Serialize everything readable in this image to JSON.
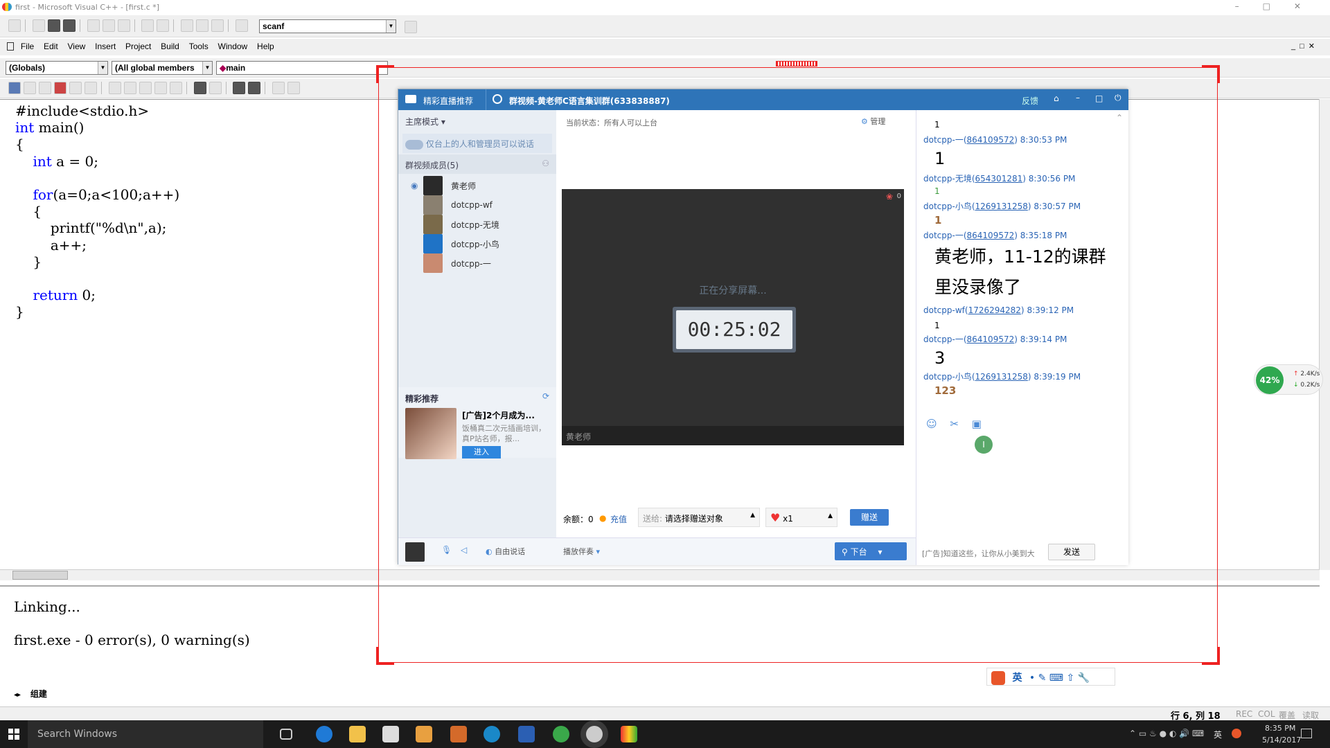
{
  "app": {
    "title": "first - Microsoft Visual C++ - [first.c *]"
  },
  "toolbar": {
    "find_combo": "scanf"
  },
  "menu": [
    "File",
    "Edit",
    "View",
    "Insert",
    "Project",
    "Build",
    "Tools",
    "Window",
    "Help"
  ],
  "wizard": {
    "class_combo": "(Globals)",
    "members_combo": "(All global members",
    "func_combo": "main"
  },
  "editor": {
    "lines": [
      "#include<stdio.h>",
      "int main()",
      "{",
      "    int a = 0;",
      "",
      "    for(a=0;a<100;a++)",
      "    {",
      "        printf(\"%d\\n\",a);",
      "        a++;",
      "    }",
      "",
      "    return 0;",
      "}"
    ]
  },
  "output": {
    "lines": [
      "Linking...",
      "first.exe - 0 error(s), 0 warning(s)"
    ],
    "tab_label": "组建"
  },
  "statusbar": {
    "position": "行 6, 列 18",
    "flags": [
      "REC",
      "COL",
      "覆盖",
      "读取"
    ]
  },
  "qq": {
    "tab_recommend": "精彩直播推荐",
    "window_title": "群视频-黄老师C语言集训群(633838887)",
    "header_actions": [
      "反馈"
    ],
    "mode_label": "主席模式",
    "speak_notice": "仅台上的人和管理员可以说话",
    "members_header": "群视频成员(5)",
    "members": [
      "黄老师",
      "dotcpp-wf",
      "dotcpp-无境",
      "dotcpp-小鸟",
      "dotcpp-一"
    ],
    "status_text": "当前状态：所有人可以上台",
    "manage_label": "管理",
    "video_count": "0",
    "sharing_text": "正在分享屏幕...",
    "timer": "00:25:02",
    "video_owner": "黄老师",
    "promo_title": "精彩推荐",
    "promo_headline": "[广告]2个月成为...",
    "promo_desc": "饭桶真二次元插画培训，真P站名师，报...",
    "promo_button": "进入",
    "balance_label": "余额：0",
    "recharge": "充值",
    "gift_to_label": "送给:",
    "gift_target": "请选择赠送对象",
    "gift_count": "x1",
    "gift_send": "赠送",
    "free_talk": "自由说话",
    "companion": "播放伴奏",
    "leave_stage": "下台",
    "chat": [
      {
        "nick": "",
        "id": "",
        "time": "",
        "text": "1",
        "size": "small"
      },
      {
        "nick": "dotcpp-一",
        "id": "864109572",
        "time": "8:30:53 PM",
        "text": "1",
        "size": "big"
      },
      {
        "nick": "dotcpp-无境",
        "id": "654301281",
        "time": "8:30:56 PM",
        "text": "1",
        "size": "green"
      },
      {
        "nick": "dotcpp-小鸟",
        "id": "1269131258",
        "time": "8:30:57 PM",
        "text": "1",
        "size": "brown"
      },
      {
        "nick": "dotcpp-一",
        "id": "864109572",
        "time": "8:35:18 PM",
        "text": "黄老师，11-12的课群里没录像了",
        "size": "huge"
      },
      {
        "nick": "dotcpp-wf",
        "id": "1726294282",
        "time": "8:39:12 PM",
        "text": "1",
        "size": "small"
      },
      {
        "nick": "dotcpp-一",
        "id": "864109572",
        "time": "8:39:14 PM",
        "text": "3",
        "size": "big"
      },
      {
        "nick": "dotcpp-小鸟",
        "id": "1269131258",
        "time": "8:39:19 PM",
        "text": "123",
        "size": "brown"
      }
    ],
    "input_ad": "[广告]知道这些，让你从小美到大",
    "send": "发送"
  },
  "netmeter": {
    "percent": "42%",
    "up": "2.4K/s",
    "down": "0.2K/s"
  },
  "ime": {
    "mode": "英"
  },
  "taskbar": {
    "search": "Search Windows",
    "time": "8:35 PM",
    "date": "5/14/2017",
    "lang": "英"
  }
}
